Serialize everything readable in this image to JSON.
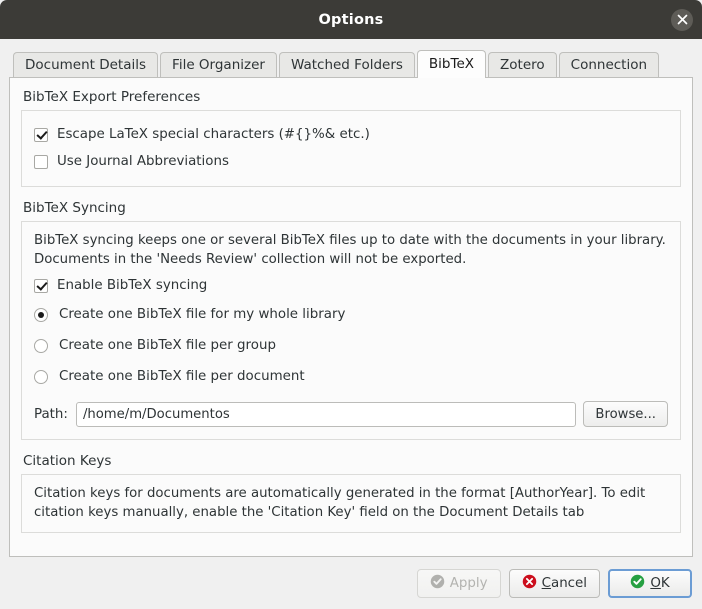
{
  "window": {
    "title": "Options",
    "close_icon": "close-icon"
  },
  "tabs": [
    {
      "label": "Document Details",
      "active": false
    },
    {
      "label": "File Organizer",
      "active": false
    },
    {
      "label": "Watched Folders",
      "active": false
    },
    {
      "label": "BibTeX",
      "active": true
    },
    {
      "label": "Zotero",
      "active": false
    },
    {
      "label": "Connection",
      "active": false
    }
  ],
  "export_preferences": {
    "title": "BibTeX Export Preferences",
    "options": [
      {
        "label": "Escape LaTeX special characters (#{}%& etc.)",
        "checked": true
      },
      {
        "label": "Use Journal Abbreviations",
        "checked": false
      }
    ]
  },
  "syncing": {
    "title": "BibTeX Syncing",
    "description": "BibTeX syncing keeps one or several BibTeX files up to date with the documents in your library. Documents in the 'Needs Review' collection will not be exported.",
    "enable_checkbox": {
      "label": "Enable BibTeX syncing",
      "checked": true
    },
    "radio_options": [
      {
        "label": "Create one BibTeX file for my whole library",
        "selected": true
      },
      {
        "label": "Create one BibTeX file per group",
        "selected": false
      },
      {
        "label": "Create one BibTeX file per document",
        "selected": false
      }
    ],
    "path": {
      "label": "Path:",
      "value": "/home/m/Documentos",
      "placeholder": "",
      "browse_label": "Browse..."
    }
  },
  "citation_keys": {
    "title": "Citation Keys",
    "description": "Citation keys for documents are automatically generated in the format [AuthorYear]. To edit citation keys manually, enable the 'Citation Key' field on the Document Details tab"
  },
  "footer": {
    "apply": {
      "label": "Apply",
      "icon": "check-circle-icon",
      "enabled": false
    },
    "cancel": {
      "label": "Cancel",
      "mnemonic_prefix": "",
      "mnemonic": "C",
      "mnemonic_suffix": "ancel",
      "icon": "cancel-circle-icon"
    },
    "ok": {
      "label": "OK",
      "mnemonic": "O",
      "mnemonic_suffix": "K",
      "icon": "check-circle-icon",
      "focused": true
    }
  },
  "colors": {
    "titlebar": "#3c3b37",
    "ok_icon": "#26a042",
    "cancel_icon": "#cc0e1d",
    "apply_icon_disabled": "#b0b0ad",
    "focus_border": "#6b9cd4",
    "dialog_bg": "#f0f0f0",
    "panel_bg": "#fbfbfb"
  }
}
